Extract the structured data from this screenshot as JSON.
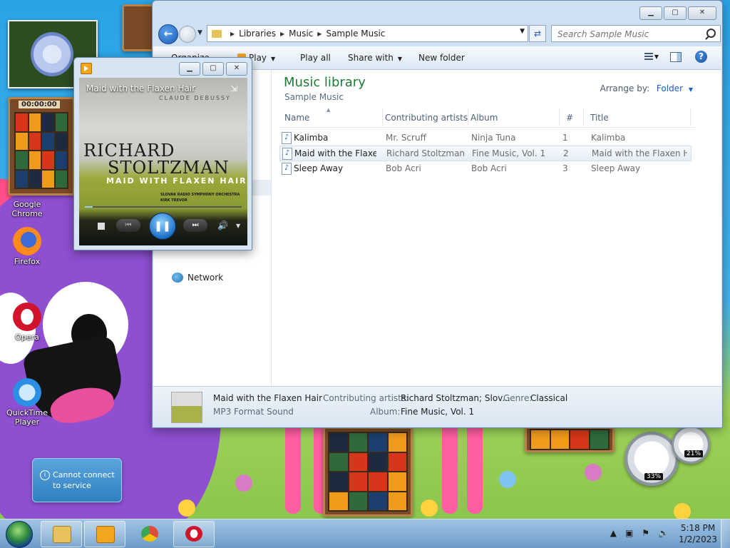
{
  "desktop": {
    "icons": [
      {
        "label": "Google Chrome"
      },
      {
        "label": "Firefox"
      },
      {
        "label": "Opera"
      },
      {
        "label": "QuickTime Player"
      }
    ],
    "gadgets": {
      "puzzle_time": "00:00:00",
      "gauge_cpu": "33%",
      "gauge_mem": "21%"
    },
    "notification": {
      "text_line1": "Cannot connect",
      "text_line2": "to service"
    }
  },
  "explorer": {
    "breadcrumb": [
      "Libraries",
      "Music",
      "Sample Music"
    ],
    "search_placeholder": "Search Sample Music",
    "toolbar": {
      "organize": "Organize",
      "play": "Play",
      "play_all": "Play all",
      "share_with": "Share with",
      "new_folder": "New folder"
    },
    "nav_pane": {
      "network": "Network"
    },
    "library": {
      "title": "Music library",
      "subtitle": "Sample Music",
      "arrange_label": "Arrange by:",
      "arrange_value": "Folder"
    },
    "columns": {
      "name": "Name",
      "artists": "Contributing artists",
      "album": "Album",
      "number": "#",
      "title": "Title"
    },
    "rows": [
      {
        "name": "Kalimba",
        "artists": "Mr. Scruff",
        "album": "Ninja Tuna",
        "number": "1",
        "title": "Kalimba"
      },
      {
        "name": "Maid with the Flaxe...",
        "artists": "Richard Stoltzman...",
        "album": "Fine Music, Vol. 1",
        "number": "2",
        "title": "Maid with the Flaxen H..."
      },
      {
        "name": "Sleep Away",
        "artists": "Bob Acri",
        "album": "Bob Acri",
        "number": "3",
        "title": "Sleep Away"
      }
    ],
    "details": {
      "title": "Maid with the Flaxen Hair",
      "type": "MP3 Format Sound",
      "artists_label": "Contributing artists:",
      "artists_value": "Richard Stoltzman; Slov...",
      "genre_label": "Genre:",
      "genre_value": "Classical",
      "album_label": "Album:",
      "album_value": "Fine Music, Vol. 1"
    }
  },
  "media_player": {
    "now_playing": "Maid with the Flaxen Hair",
    "art": {
      "composer": "CLAUDE DEBUSSY",
      "artist_line1": "RICHARD",
      "artist_line2": "STOLTZMAN",
      "work": "MAID WITH FLAXEN HAIR",
      "orchestra_line1": "SLOVAK RADIO SYMPHONY ORCHESTRA",
      "orchestra_line2": "KIRK TREVOR"
    },
    "progress": 0.05
  },
  "taskbar": {
    "clock_time": "5:18 PM",
    "clock_date": "1/2/2023"
  },
  "colors": {
    "library_title": "#1e7a36",
    "link_blue": "#1f5ec1"
  }
}
